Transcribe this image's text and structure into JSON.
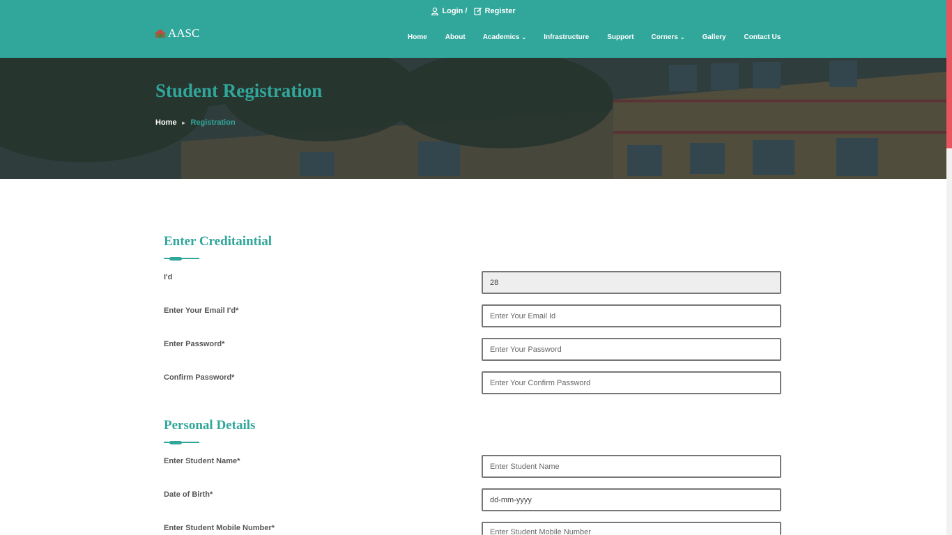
{
  "topbar": {
    "login_label": "Login /",
    "register_label": "Register"
  },
  "logo": {
    "text": "AASC"
  },
  "nav": {
    "items": [
      {
        "label": "Home",
        "icon": ""
      },
      {
        "label": "About",
        "icon": ""
      },
      {
        "label": "Academics",
        "icon": "chevron-down"
      },
      {
        "label": "Infrastructure",
        "icon": ""
      },
      {
        "label": "Support",
        "icon": ""
      },
      {
        "label": "Corners",
        "icon": "chevron-down"
      },
      {
        "label": "Gallery",
        "icon": ""
      },
      {
        "label": "Contact Us",
        "icon": ""
      }
    ]
  },
  "hero": {
    "title": "Student Registration",
    "breadcrumb": {
      "home": "Home",
      "separator": "►",
      "current": "Registration"
    }
  },
  "credentials": {
    "title": "Enter Creditaintial",
    "id_label": "I'd",
    "id_value": "28",
    "email_label": "Enter Your Email I'd*",
    "email_placeholder": "Enter Your Email Id",
    "password_label": "Enter Password*",
    "password_placeholder": "Enter Your Password",
    "confirm_label": "Confirm Password*",
    "confirm_placeholder": "Enter Your Confirm Password"
  },
  "personal": {
    "title": "Personal Details",
    "name_label": "Enter Student Name*",
    "name_placeholder": "Enter Student Name",
    "dob_label": "Date of Birth*",
    "dob_value": "dd-mm-yyyy",
    "mobile_label": "Enter Student Mobile Number*",
    "mobile_placeholder": "Enter Student Mobile Number"
  },
  "colors": {
    "accent": "#31a69b",
    "scroll_thumb": "#e8545f"
  }
}
